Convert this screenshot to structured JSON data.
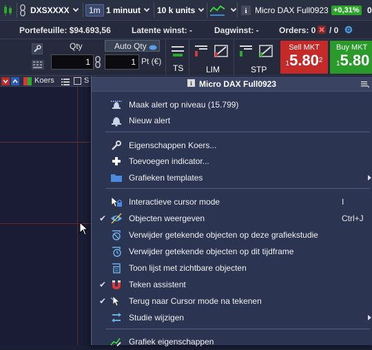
{
  "topbar": {
    "symbol": "DXSXXXX",
    "timeframe_badge": "1m",
    "interval": "1 minuut",
    "units": "10 k units",
    "instrument": "Micro DAX Full0923",
    "change_pct": "+0,31%",
    "extra": "0"
  },
  "infobar": {
    "portefeuille": "Portefeuille: $94.693,56",
    "latente": "Latente winst: -",
    "dagwinst": "Dagwinst: -",
    "orders": "Orders: 0",
    "orders_count": "/ 0"
  },
  "orderbar": {
    "qty_label": "Qty",
    "qty_value": "1",
    "auto_qty_label": "Auto Qty",
    "auto_qty_value": "1",
    "pt_label": "Pt (€)",
    "ts_label": "TS",
    "lim_label": "LIM",
    "stp_label": "STP",
    "sell_label": "Sell MKT",
    "sell_prefix": "1",
    "sell_price": "5.80",
    "sell_sup": "2",
    "buy_label": "Buy MKT",
    "buy_prefix": "1",
    "buy_price": "5.80"
  },
  "chartbar": {
    "koers_label": "Koers",
    "s_label": "S"
  },
  "menu": {
    "title": "Micro DAX Full0923",
    "items": [
      {
        "label": "Maak alert op niveau (15.799)"
      },
      {
        "label": "Nieuw alert"
      },
      {
        "label": "Eigenschappen Koers..."
      },
      {
        "label": "Toevoegen indicator..."
      },
      {
        "label": "Grafieken templates"
      },
      {
        "label": "Interactieve cursor mode",
        "shortcut": "I"
      },
      {
        "label": "Objecten weergeven",
        "shortcut": "Ctrl+J"
      },
      {
        "label": "Verwijder getekende objecten op deze grafiekstudie"
      },
      {
        "label": "Verwijder getekende objecten op dit tijdframe"
      },
      {
        "label": "Toon lijst met zichtbare objecten"
      },
      {
        "label": "Teken assistent"
      },
      {
        "label": "Terug naar Cursor mode na tekenen"
      },
      {
        "label": "Studie wijzigen"
      },
      {
        "label": "Grafiek eigenschappen"
      }
    ]
  },
  "colors": {
    "sell": "#c42a2a",
    "buy": "#2a9a2a",
    "positive_badge": "#2aa52a",
    "menu_bg": "#2b3450"
  }
}
